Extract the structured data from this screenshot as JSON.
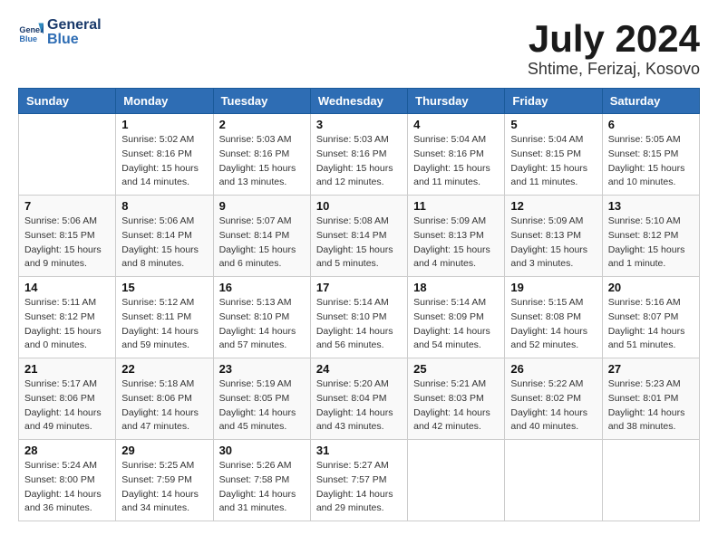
{
  "header": {
    "logo_text_general": "General",
    "logo_text_blue": "Blue",
    "month_year": "July 2024",
    "location": "Shtime, Ferizaj, Kosovo"
  },
  "weekdays": [
    "Sunday",
    "Monday",
    "Tuesday",
    "Wednesday",
    "Thursday",
    "Friday",
    "Saturday"
  ],
  "weeks": [
    [
      {
        "day": "",
        "sunrise": "",
        "sunset": "",
        "daylight": ""
      },
      {
        "day": "1",
        "sunrise": "Sunrise: 5:02 AM",
        "sunset": "Sunset: 8:16 PM",
        "daylight": "Daylight: 15 hours and 14 minutes."
      },
      {
        "day": "2",
        "sunrise": "Sunrise: 5:03 AM",
        "sunset": "Sunset: 8:16 PM",
        "daylight": "Daylight: 15 hours and 13 minutes."
      },
      {
        "day": "3",
        "sunrise": "Sunrise: 5:03 AM",
        "sunset": "Sunset: 8:16 PM",
        "daylight": "Daylight: 15 hours and 12 minutes."
      },
      {
        "day": "4",
        "sunrise": "Sunrise: 5:04 AM",
        "sunset": "Sunset: 8:16 PM",
        "daylight": "Daylight: 15 hours and 11 minutes."
      },
      {
        "day": "5",
        "sunrise": "Sunrise: 5:04 AM",
        "sunset": "Sunset: 8:15 PM",
        "daylight": "Daylight: 15 hours and 11 minutes."
      },
      {
        "day": "6",
        "sunrise": "Sunrise: 5:05 AM",
        "sunset": "Sunset: 8:15 PM",
        "daylight": "Daylight: 15 hours and 10 minutes."
      }
    ],
    [
      {
        "day": "7",
        "sunrise": "Sunrise: 5:06 AM",
        "sunset": "Sunset: 8:15 PM",
        "daylight": "Daylight: 15 hours and 9 minutes."
      },
      {
        "day": "8",
        "sunrise": "Sunrise: 5:06 AM",
        "sunset": "Sunset: 8:14 PM",
        "daylight": "Daylight: 15 hours and 8 minutes."
      },
      {
        "day": "9",
        "sunrise": "Sunrise: 5:07 AM",
        "sunset": "Sunset: 8:14 PM",
        "daylight": "Daylight: 15 hours and 6 minutes."
      },
      {
        "day": "10",
        "sunrise": "Sunrise: 5:08 AM",
        "sunset": "Sunset: 8:14 PM",
        "daylight": "Daylight: 15 hours and 5 minutes."
      },
      {
        "day": "11",
        "sunrise": "Sunrise: 5:09 AM",
        "sunset": "Sunset: 8:13 PM",
        "daylight": "Daylight: 15 hours and 4 minutes."
      },
      {
        "day": "12",
        "sunrise": "Sunrise: 5:09 AM",
        "sunset": "Sunset: 8:13 PM",
        "daylight": "Daylight: 15 hours and 3 minutes."
      },
      {
        "day": "13",
        "sunrise": "Sunrise: 5:10 AM",
        "sunset": "Sunset: 8:12 PM",
        "daylight": "Daylight: 15 hours and 1 minute."
      }
    ],
    [
      {
        "day": "14",
        "sunrise": "Sunrise: 5:11 AM",
        "sunset": "Sunset: 8:12 PM",
        "daylight": "Daylight: 15 hours and 0 minutes."
      },
      {
        "day": "15",
        "sunrise": "Sunrise: 5:12 AM",
        "sunset": "Sunset: 8:11 PM",
        "daylight": "Daylight: 14 hours and 59 minutes."
      },
      {
        "day": "16",
        "sunrise": "Sunrise: 5:13 AM",
        "sunset": "Sunset: 8:10 PM",
        "daylight": "Daylight: 14 hours and 57 minutes."
      },
      {
        "day": "17",
        "sunrise": "Sunrise: 5:14 AM",
        "sunset": "Sunset: 8:10 PM",
        "daylight": "Daylight: 14 hours and 56 minutes."
      },
      {
        "day": "18",
        "sunrise": "Sunrise: 5:14 AM",
        "sunset": "Sunset: 8:09 PM",
        "daylight": "Daylight: 14 hours and 54 minutes."
      },
      {
        "day": "19",
        "sunrise": "Sunrise: 5:15 AM",
        "sunset": "Sunset: 8:08 PM",
        "daylight": "Daylight: 14 hours and 52 minutes."
      },
      {
        "day": "20",
        "sunrise": "Sunrise: 5:16 AM",
        "sunset": "Sunset: 8:07 PM",
        "daylight": "Daylight: 14 hours and 51 minutes."
      }
    ],
    [
      {
        "day": "21",
        "sunrise": "Sunrise: 5:17 AM",
        "sunset": "Sunset: 8:06 PM",
        "daylight": "Daylight: 14 hours and 49 minutes."
      },
      {
        "day": "22",
        "sunrise": "Sunrise: 5:18 AM",
        "sunset": "Sunset: 8:06 PM",
        "daylight": "Daylight: 14 hours and 47 minutes."
      },
      {
        "day": "23",
        "sunrise": "Sunrise: 5:19 AM",
        "sunset": "Sunset: 8:05 PM",
        "daylight": "Daylight: 14 hours and 45 minutes."
      },
      {
        "day": "24",
        "sunrise": "Sunrise: 5:20 AM",
        "sunset": "Sunset: 8:04 PM",
        "daylight": "Daylight: 14 hours and 43 minutes."
      },
      {
        "day": "25",
        "sunrise": "Sunrise: 5:21 AM",
        "sunset": "Sunset: 8:03 PM",
        "daylight": "Daylight: 14 hours and 42 minutes."
      },
      {
        "day": "26",
        "sunrise": "Sunrise: 5:22 AM",
        "sunset": "Sunset: 8:02 PM",
        "daylight": "Daylight: 14 hours and 40 minutes."
      },
      {
        "day": "27",
        "sunrise": "Sunrise: 5:23 AM",
        "sunset": "Sunset: 8:01 PM",
        "daylight": "Daylight: 14 hours and 38 minutes."
      }
    ],
    [
      {
        "day": "28",
        "sunrise": "Sunrise: 5:24 AM",
        "sunset": "Sunset: 8:00 PM",
        "daylight": "Daylight: 14 hours and 36 minutes."
      },
      {
        "day": "29",
        "sunrise": "Sunrise: 5:25 AM",
        "sunset": "Sunset: 7:59 PM",
        "daylight": "Daylight: 14 hours and 34 minutes."
      },
      {
        "day": "30",
        "sunrise": "Sunrise: 5:26 AM",
        "sunset": "Sunset: 7:58 PM",
        "daylight": "Daylight: 14 hours and 31 minutes."
      },
      {
        "day": "31",
        "sunrise": "Sunrise: 5:27 AM",
        "sunset": "Sunset: 7:57 PM",
        "daylight": "Daylight: 14 hours and 29 minutes."
      },
      {
        "day": "",
        "sunrise": "",
        "sunset": "",
        "daylight": ""
      },
      {
        "day": "",
        "sunrise": "",
        "sunset": "",
        "daylight": ""
      },
      {
        "day": "",
        "sunrise": "",
        "sunset": "",
        "daylight": ""
      }
    ]
  ]
}
